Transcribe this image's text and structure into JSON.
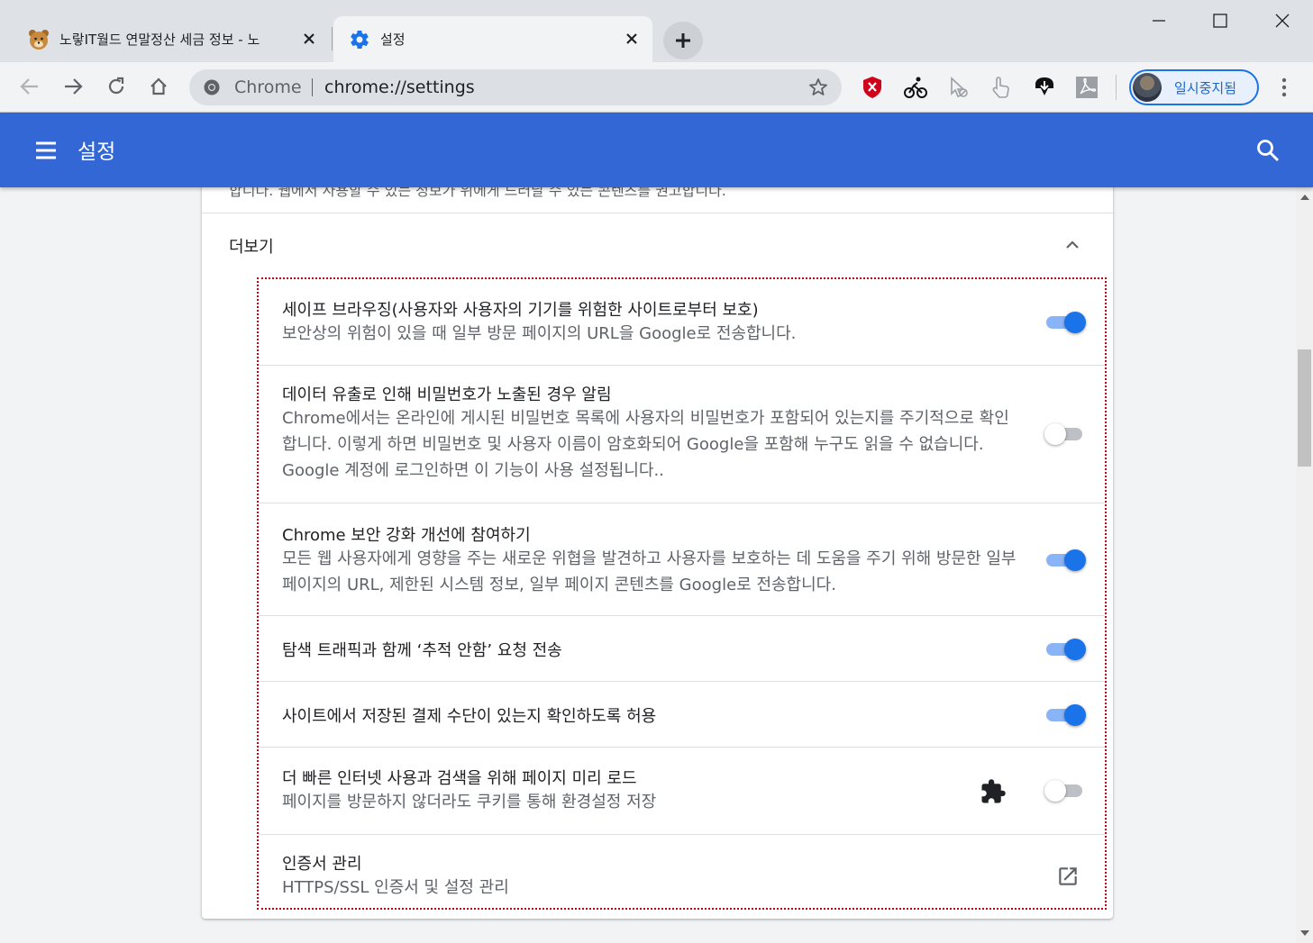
{
  "tabs": [
    {
      "title": "노랗IT월드 연말정산 세금 정보 - 노",
      "favicon": "bear-favicon"
    },
    {
      "title": "설정",
      "favicon": "gear-icon"
    }
  ],
  "toolbar": {
    "chip_label": "Chrome",
    "url": "chrome://settings",
    "profile_label": "일시중지됨"
  },
  "header": {
    "title": "설정"
  },
  "section": {
    "cut_text": "합니다. 웹에서 사용할 수 있는 정보가 위에게 드러날 수 있는 콘텐츠를 권고합니다.",
    "more_label": "더보기"
  },
  "settings": [
    {
      "label": "세이프 브라우징(사용자와 사용자의 기기를 위험한 사이트로부터 보호)",
      "desc": "보안상의 위험이 있을 때 일부 방문 페이지의 URL을 Google로 전송합니다.",
      "toggle": "on"
    },
    {
      "label": "데이터 유출로 인해 비밀번호가 노출된 경우 알림",
      "desc": "Chrome에서는 온라인에 게시된 비밀번호 목록에 사용자의 비밀번호가 포함되어 있는지를 주기적으로 확인합니다. 이렇게 하면 비밀번호 및 사용자 이름이 암호화되어 Google을 포함해 누구도 읽을 수 없습니다. Google 계정에 로그인하면 이 기능이 사용 설정됩니다..",
      "toggle": "off"
    },
    {
      "label": "Chrome 보안 강화 개선에 참여하기",
      "desc": "모든 웹 사용자에게 영향을 주는 새로운 위협을 발견하고 사용자를 보호하는 데 도움을 주기 위해 방문한 일부 페이지의 URL, 제한된 시스템 정보, 일부 페이지 콘텐츠를 Google로 전송합니다.",
      "toggle": "on"
    },
    {
      "label": "탐색 트래픽과 함께 ‘추적 안함’ 요청 전송",
      "toggle": "on"
    },
    {
      "label": "사이트에서 저장된 결제 수단이 있는지 확인하도록 허용",
      "toggle": "on"
    },
    {
      "label": "더 빠른 인터넷 사용과 검색을 위해 페이지 미리 로드",
      "desc": "페이지를 방문하지 않더라도 쿠키를 통해 환경설정 저장",
      "toggle": "off",
      "extension_controlled": true
    },
    {
      "label": "인증서 관리",
      "desc": "HTTPS/SSL 인증서 및 설정 관리",
      "action": "external-link"
    }
  ],
  "colors": {
    "header_blue": "#3367d6",
    "toggle_on": "#1a73e8",
    "highlight_border": "#c00018"
  }
}
